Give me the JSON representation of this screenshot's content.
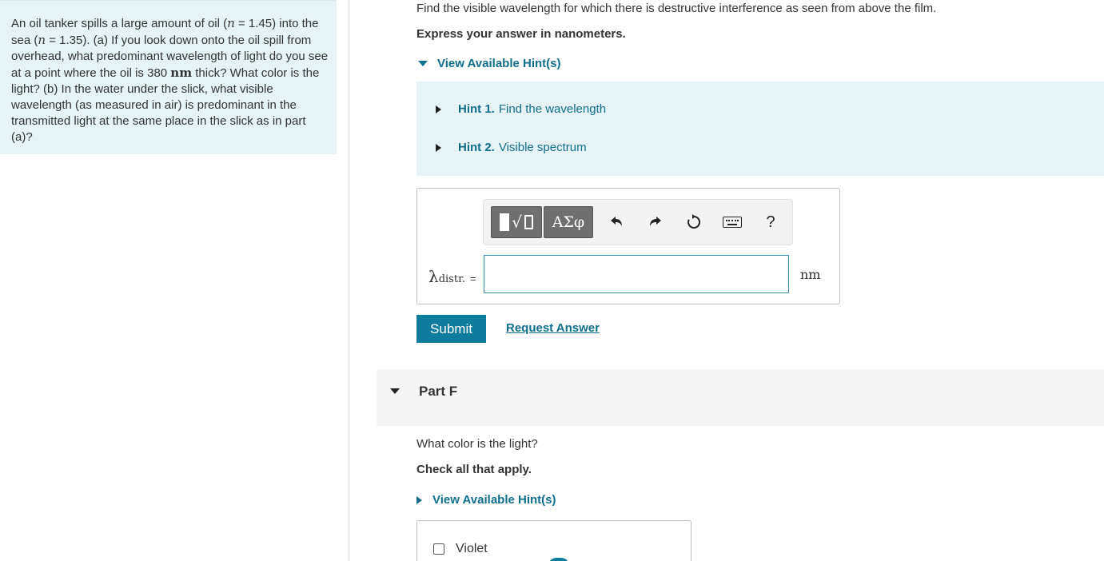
{
  "problem": {
    "part1": "An oil tanker spills a large amount of oil (",
    "n_symbol": "n",
    "part2": " = 1.45) into the sea (",
    "part3": " = 1.35). (a) If you look down onto the oil spill from overhead, what predominant wavelength of light do you see at a point where the oil is 380 ",
    "unit": "nm",
    "part4": " thick? What color is the light? (b) In the water under the slick, what visible wavelength (as measured in air) is predominant in the transmitted light at the same place in the slick as in part (a)?"
  },
  "part_e": {
    "question": "Find the visible wavelength for which there is destructive interference as seen from above the film.",
    "instruction": "Express your answer in nanometers.",
    "hints_toggle": "View Available Hint(s)",
    "hints": [
      {
        "number": "Hint 1.",
        "title": "Find the wavelength"
      },
      {
        "number": "Hint 2.",
        "title": "Visible spectrum"
      }
    ],
    "toolbar": {
      "greek_label": "ΑΣφ",
      "help_label": "?"
    },
    "variable_symbol": "λ",
    "variable_subscript": "distr.",
    "equals": "=",
    "input_value": "",
    "unit": "nm",
    "submit_label": "Submit",
    "request_label": "Request Answer"
  },
  "part_f": {
    "title": "Part F",
    "question": "What color is the light?",
    "instruction": "Check all that apply.",
    "hints_toggle": "View Available Hint(s)",
    "options": [
      "Violet"
    ]
  },
  "colors": {
    "accent": "#0e7c9c",
    "link": "#0f6f8c",
    "panel_bg": "#e6f4f7"
  }
}
